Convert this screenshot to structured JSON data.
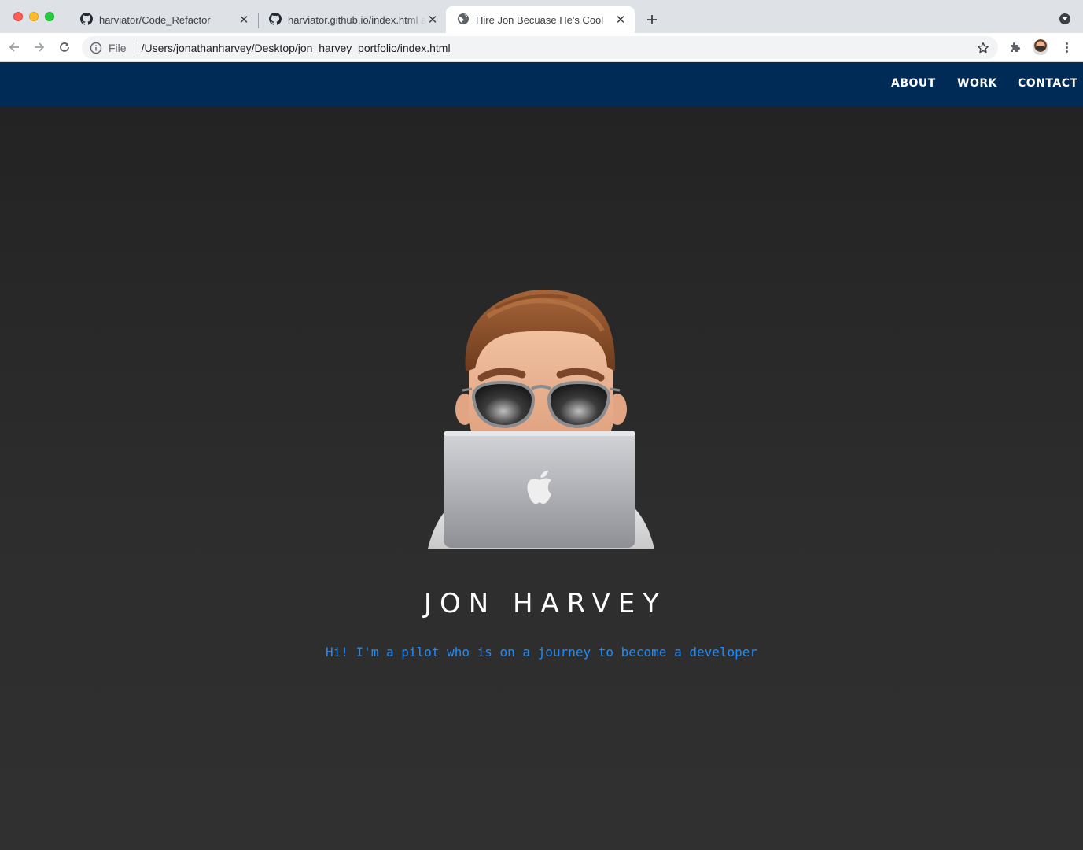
{
  "browser": {
    "tabs": [
      {
        "title": "harviator/Code_Refactor",
        "icon": "github-icon",
        "active": false
      },
      {
        "title": "harviator.github.io/index.html a",
        "icon": "github-icon",
        "active": false
      },
      {
        "title": "Hire Jon Becuase He's Cool",
        "icon": "globe-icon",
        "active": true
      }
    ],
    "omnibox": {
      "scheme_label": "File",
      "url": "/Users/jonathanharvey/Desktop/jon_harvey_portfolio/index.html"
    }
  },
  "site": {
    "nav": {
      "about": "ABOUT",
      "work": "WORK",
      "contact": "CONTACT"
    },
    "hero": {
      "name": "JON HARVEY",
      "tagline": "Hi! I'm a pilot who is on a journey to become a developer"
    }
  },
  "colors": {
    "nav_bg": "#012b57",
    "hero_bg": "#2a2a2a",
    "tagline": "#1a8cff"
  }
}
